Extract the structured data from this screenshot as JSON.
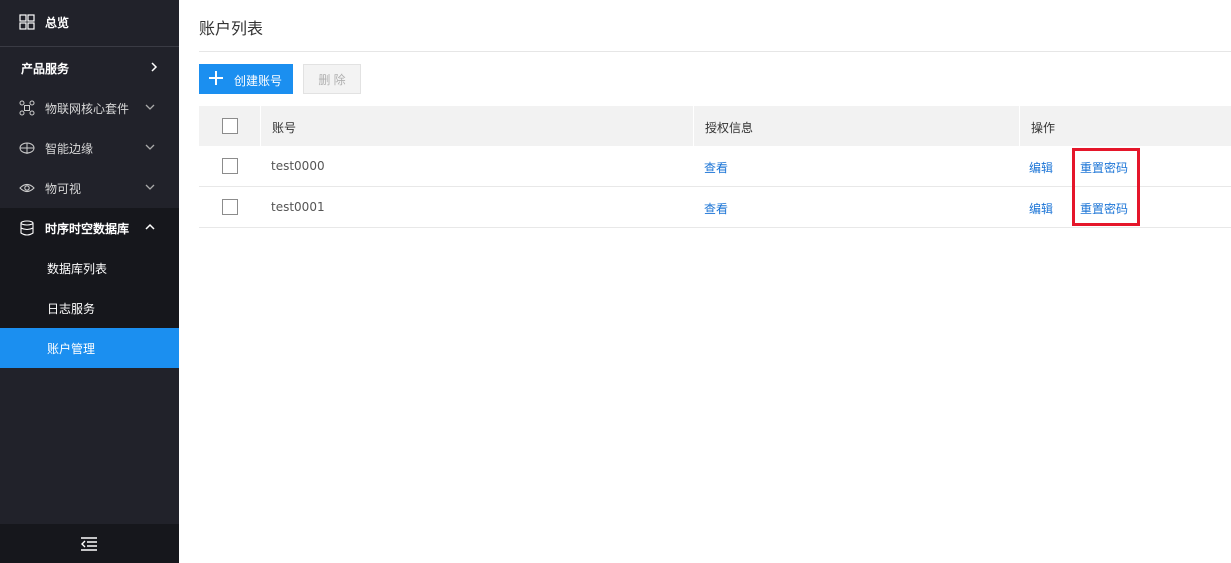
{
  "sidebar": {
    "overview": "总览",
    "product_services": "产品服务",
    "groups": [
      {
        "label": "物联网核心套件",
        "icon": "network-icon"
      },
      {
        "label": "智能边缘",
        "icon": "edge-icon"
      },
      {
        "label": "物可视",
        "icon": "eye-icon"
      },
      {
        "label": "时序时空数据库",
        "icon": "database-icon"
      }
    ],
    "sub_items": [
      "数据库列表",
      "日志服务",
      "账户管理"
    ],
    "active_sub_item": "账户管理",
    "accent": "#1b8ff0"
  },
  "page": {
    "title": "账户列表",
    "create_button": "创建账号",
    "delete_button": "删 除"
  },
  "table": {
    "headers": [
      "账号",
      "授权信息",
      "操作"
    ],
    "rows": [
      {
        "account": "test0000",
        "auth": "查看",
        "edit": "编辑",
        "reset": "重置密码"
      },
      {
        "account": "test0001",
        "auth": "查看",
        "edit": "编辑",
        "reset": "重置密码"
      }
    ]
  },
  "highlight_color": "#e5162a"
}
